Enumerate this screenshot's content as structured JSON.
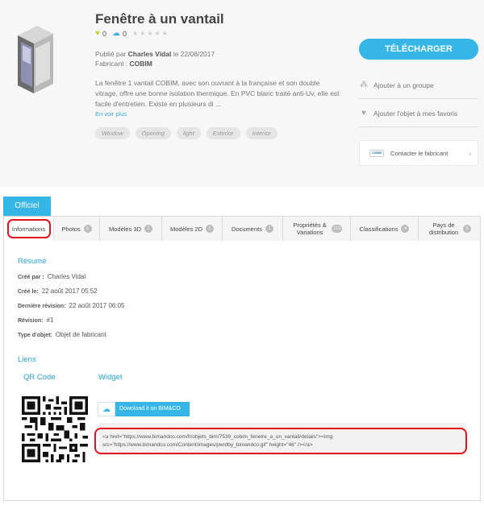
{
  "product": {
    "title": "Fenêtre à un vantail",
    "likes": "0",
    "downloads": "0",
    "stars": "★★★★★",
    "published_prefix": "Publié par ",
    "author": "Charles Vidal",
    "published_date": " le 22/08/2017",
    "manufacturer_label": "Fabricant : ",
    "manufacturer": "COBIM",
    "description": "La fenêtre 1 vantail COBIM, avec son ouvrant à la française et son double vitrage, offre une bonne isolation thermique. En PVC blanc traité anti-Uv, elle est facile d'entretien. Existe en plusieurs di ...",
    "read_more": "En voir plus",
    "tags": [
      "Window",
      "Opening",
      "light",
      "Exterior",
      "Interior"
    ]
  },
  "actions": {
    "download": "TÉLÉCHARGER",
    "add_group": "Ajouter à un groupe",
    "add_favorite": "Ajouter l'objet à mes favoris",
    "contact": "Contacter le fabricant",
    "contact_logo": "COBIM",
    "contact_arrow": "›"
  },
  "official_label": "Officiel",
  "tabs": [
    {
      "label": "Informations",
      "badge": ""
    },
    {
      "label": "Photos",
      "badge": "1"
    },
    {
      "label": "Modèles 3D",
      "badge": "1"
    },
    {
      "label": "Modèles 2D",
      "badge": "1"
    },
    {
      "label": "Documents",
      "badge": "1"
    },
    {
      "label": "Propriétés & Variations",
      "badge": "113"
    },
    {
      "label": "Classifications",
      "badge": "4"
    },
    {
      "label": "Pays de distribution",
      "badge": "0"
    }
  ],
  "summary": {
    "title": "Résumé",
    "created_by_label": "Créé par :",
    "created_by": "Charles Vidal",
    "created_on_label": "Créé le:",
    "created_on": "22 août 2017 05:52",
    "last_rev_label": "Dernière révision:",
    "last_rev": "22 août 2017 06:05",
    "revision_label": "Révision:",
    "revision": "#1",
    "type_label": "Type d'objet:",
    "type": "Objet de fabricant"
  },
  "links": {
    "title": "Liens",
    "qr_title": "QR Code",
    "widget_title": "Widget",
    "widget_button": "Download it on BIM&CO",
    "code_line1": "<a href=\"https://www.bimandco.com/fr/objets_bim/7539_cobim_fenetre_a_un_vantail/details\"><img",
    "code_line2": "src=\"https://www.bimandco.com/Content/images/pwrdby_bimandco.gif\" height=\"46\" /></a>"
  },
  "colors": {
    "accent": "#36b6e6",
    "highlight_ring": "#e2141c"
  }
}
